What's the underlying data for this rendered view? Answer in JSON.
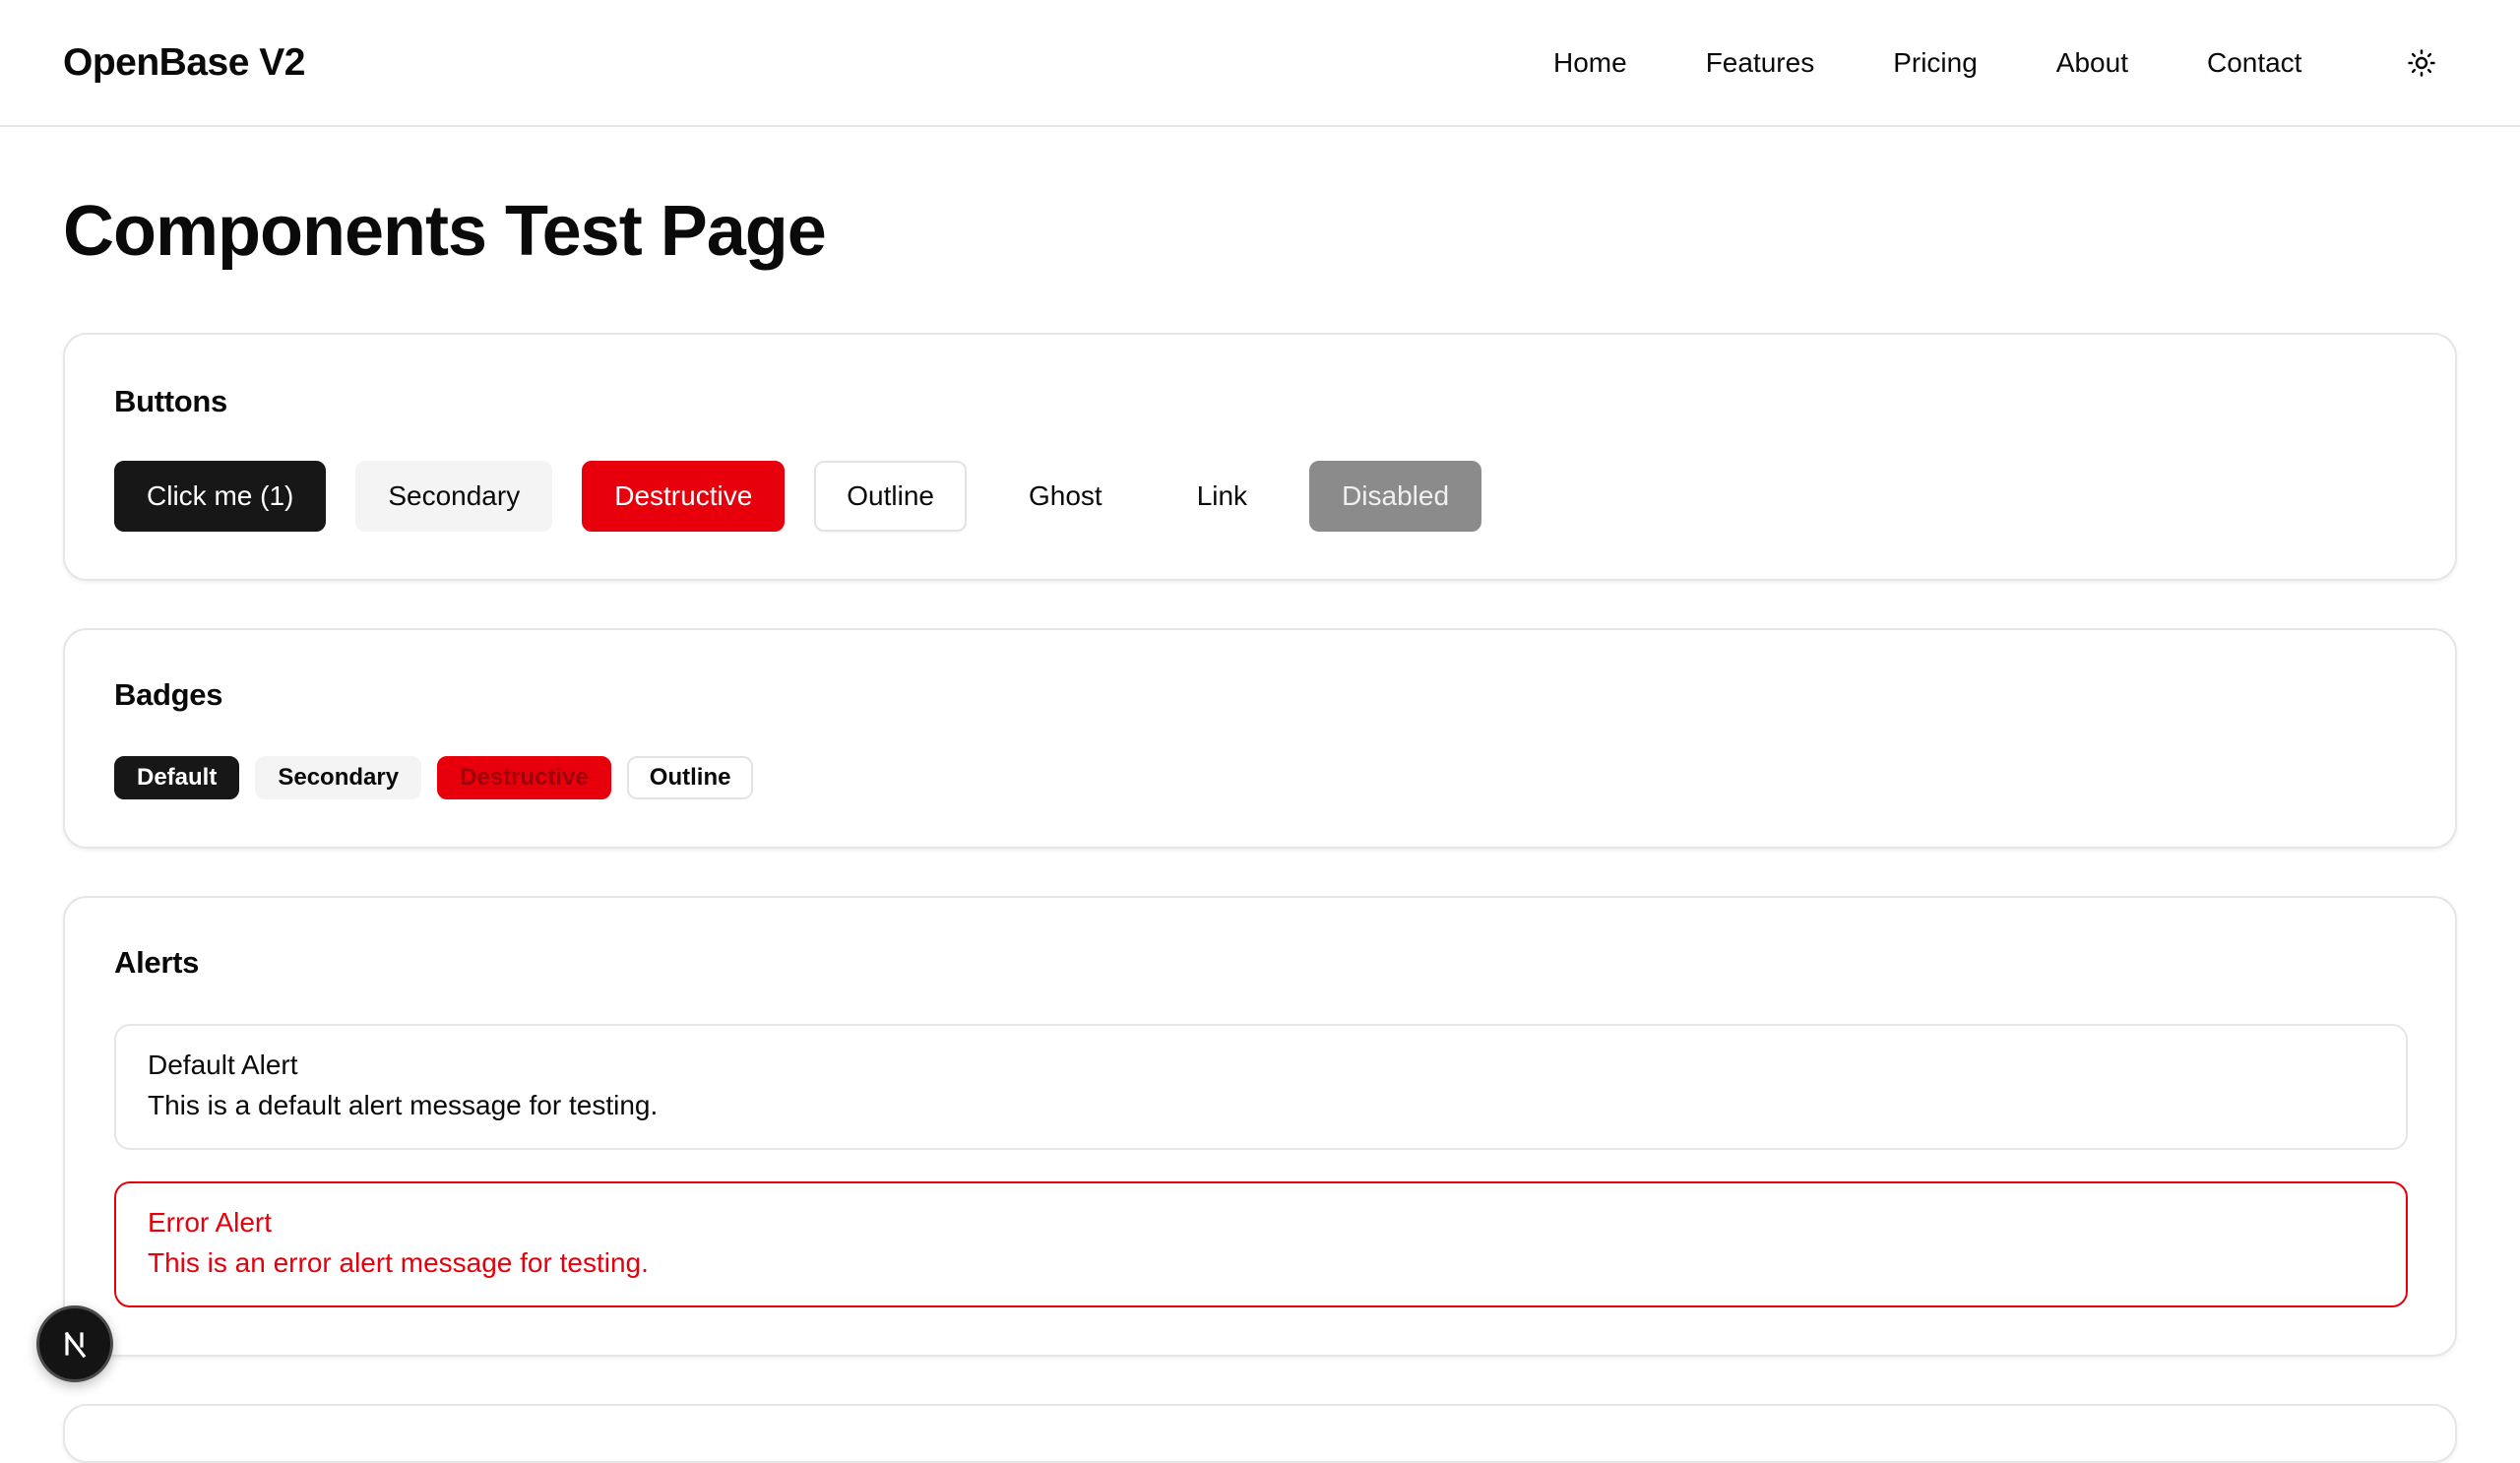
{
  "header": {
    "brand": "OpenBase V2",
    "nav": [
      "Home",
      "Features",
      "Pricing",
      "About",
      "Contact"
    ],
    "theme_toggle_icon": "sun-icon"
  },
  "page": {
    "title": "Components Test Page"
  },
  "buttons_section": {
    "title": "Buttons",
    "buttons": {
      "default": "Click me (1)",
      "secondary": "Secondary",
      "destructive": "Destructive",
      "outline": "Outline",
      "ghost": "Ghost",
      "link": "Link",
      "disabled": "Disabled"
    }
  },
  "badges_section": {
    "title": "Badges",
    "badges": {
      "default": "Default",
      "secondary": "Secondary",
      "destructive": "Destructive",
      "outline": "Outline"
    }
  },
  "alerts_section": {
    "title": "Alerts",
    "alerts": [
      {
        "variant": "default",
        "title": "Default Alert",
        "description": "This is a default alert message for testing."
      },
      {
        "variant": "error",
        "title": "Error Alert",
        "description": "This is an error alert message for testing."
      }
    ]
  },
  "floating_badge": {
    "label": "N",
    "icon": "nextjs-icon"
  },
  "colors": {
    "primary": "#171717",
    "secondary": "#f4f4f4",
    "destructive": "#e7000b",
    "border": "#e6e6e6",
    "disabled": "#8b8b8b"
  }
}
